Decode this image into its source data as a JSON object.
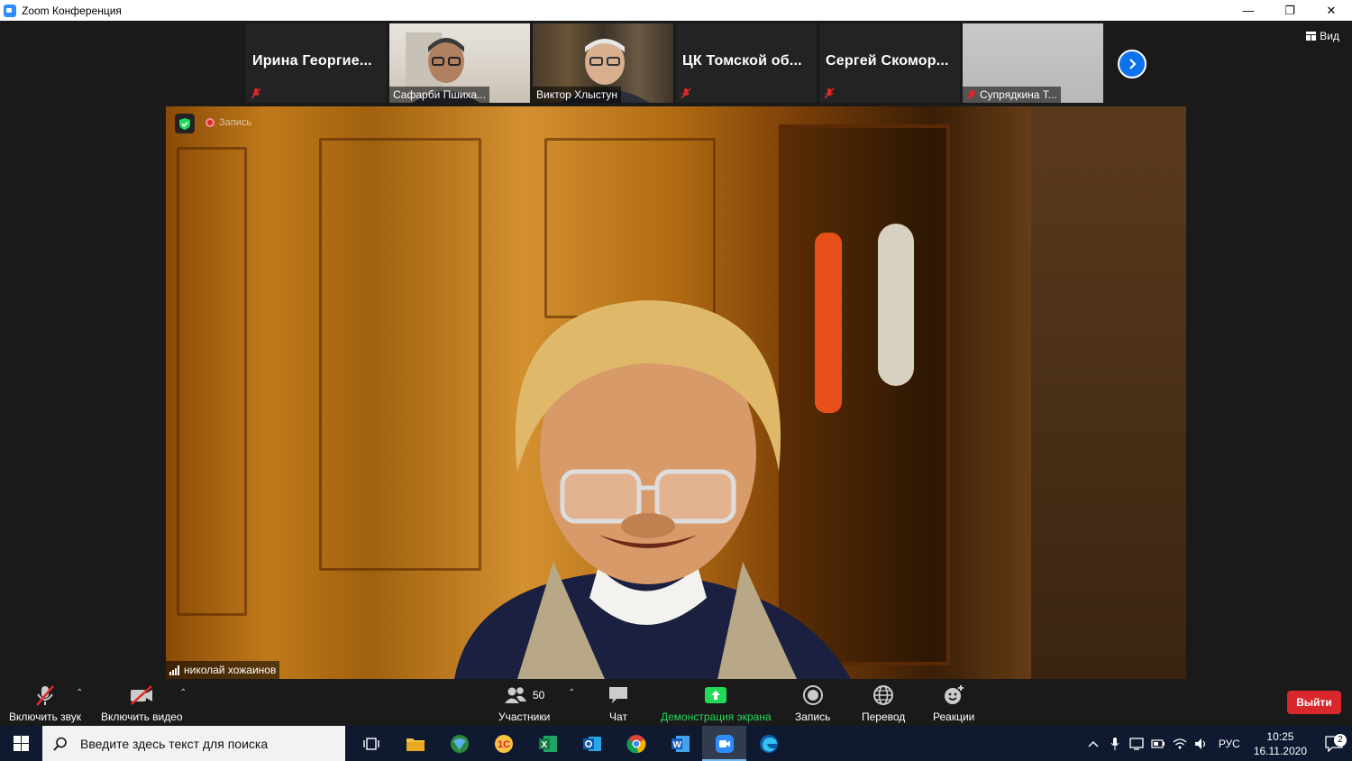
{
  "window": {
    "title": "Zoom Конференция",
    "minimize": "—",
    "maximize": "❐",
    "close": "✕"
  },
  "view_button": {
    "label": "Вид"
  },
  "participants_strip": [
    {
      "name": "Ирина Георгие...",
      "type": "name",
      "muted": true
    },
    {
      "name": "Сафарби Пшиха...",
      "type": "video",
      "muted": false
    },
    {
      "name": "Виктор Хлыстун",
      "type": "video",
      "muted": false
    },
    {
      "name": "ЦК Томской об...",
      "type": "name",
      "muted": true
    },
    {
      "name": "Сергей Скомор...",
      "type": "name",
      "muted": true
    },
    {
      "name": "Супрядкина Т...",
      "type": "video",
      "muted": true
    }
  ],
  "main_video": {
    "recording_label": "Запись",
    "speaker_name": "николай хожаинов"
  },
  "toolbar": {
    "audio": "Включить звук",
    "video": "Включить видео",
    "participants": "Участники",
    "participants_count": "50",
    "chat": "Чат",
    "share": "Демонстрация экрана",
    "record": "Запись",
    "translate": "Перевод",
    "reactions": "Реакции",
    "leave": "Выйти"
  },
  "taskbar": {
    "search_placeholder": "Введите здесь текст для поиска",
    "language": "РУС",
    "time": "10:25",
    "date": "16.11.2020",
    "notifications": "2"
  },
  "colors": {
    "accent_blue": "#0e72ed",
    "share_green": "#23d959",
    "leave_red": "#d9272e",
    "mute_red": "#e02828"
  }
}
